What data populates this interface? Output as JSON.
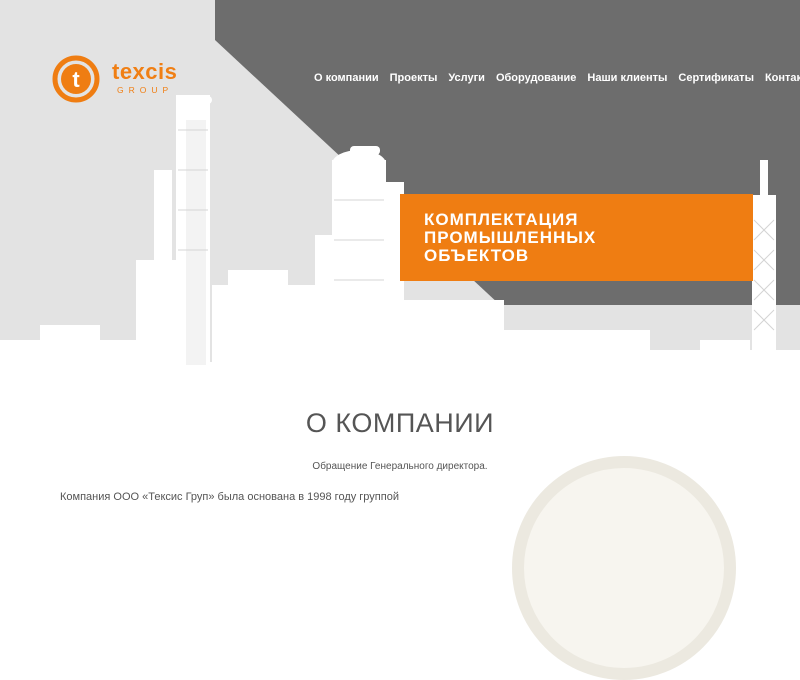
{
  "brand": {
    "name": "texcis",
    "subtitle": "GROUP",
    "logo_letter": "t",
    "accent_color": "#ef7d12"
  },
  "nav": {
    "items": [
      {
        "label": "О компании"
      },
      {
        "label": "Проекты"
      },
      {
        "label": "Услуги"
      },
      {
        "label": "Оборудование"
      },
      {
        "label": "Наши клиенты"
      },
      {
        "label": "Сертификаты"
      },
      {
        "label": "Контакты"
      }
    ]
  },
  "hero": {
    "headline": "КОМПЛЕКТАЦИЯ\nПРОМЫШЛЕННЫХ\nОБЪЕКТОВ",
    "background_color": "#6d6d6d"
  },
  "about": {
    "title": "О КОМПАНИИ",
    "subtitle": "Обращение Генерального директора.",
    "intro": "Компания ООО «Тексис Груп» была основана в 1998 году группой"
  }
}
